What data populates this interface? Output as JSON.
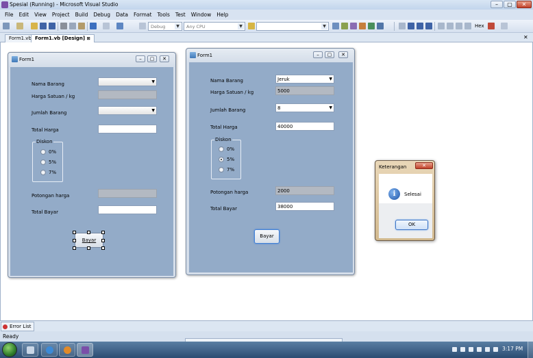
{
  "window": {
    "title": "Spesial (Running) - Microsoft Visual Studio",
    "minimize": "–",
    "maximize": "▢",
    "close": "✕"
  },
  "menu": [
    "File",
    "Edit",
    "View",
    "Project",
    "Build",
    "Debug",
    "Data",
    "Format",
    "Tools",
    "Test",
    "Window",
    "Help"
  ],
  "toolbar": {
    "config": "Debug",
    "platform": "Any CPU",
    "search": "",
    "hex_label": "Hex"
  },
  "tabs": {
    "first": "Form1.vb",
    "second": "Form1.vb [Design]",
    "pin_icon": "⊠",
    "close_icon": "✕"
  },
  "design_form": {
    "title": "Form1",
    "labels": {
      "nama": "Nama Barang",
      "harga": "Harga Satuan / kg",
      "jumlah": "Jumlah Barang",
      "total": "Total Harga",
      "diskon": "Diskon",
      "potongan": "Potongan harga",
      "bayar_total": "Total Bayar"
    },
    "radios": [
      "0%",
      "5%",
      "7%"
    ],
    "button": "Bayar"
  },
  "running_form": {
    "title": "Form1",
    "labels": {
      "nama": "Nama Barang",
      "harga": "Harga Satuan / kg",
      "jumlah": "Jumlah Barang",
      "total": "Total Harga",
      "diskon": "Diskon",
      "potongan": "Potongan harga",
      "bayar_total": "Total Bayar"
    },
    "values": {
      "nama": "Jeruk",
      "harga": "5000",
      "jumlah": "8",
      "total": "40000",
      "potongan": "2000",
      "bayar_total": "38000"
    },
    "radios": [
      "0%",
      "5%",
      "7%"
    ],
    "selected_radio": "5%",
    "button": "Bayar"
  },
  "message_box": {
    "title": "Keterangan",
    "message": "Selesai",
    "ok": "OK",
    "icon": "info-icon",
    "icon_glyph": "i"
  },
  "bottom": {
    "error_tab": "Error List",
    "status": "Ready"
  },
  "taskbar": {
    "clock": "3:17 PM"
  },
  "colors": {
    "form_client": "#93abc8",
    "readonly_box": "#b3b9c2",
    "msgbox_frame": "#d2b98e"
  }
}
